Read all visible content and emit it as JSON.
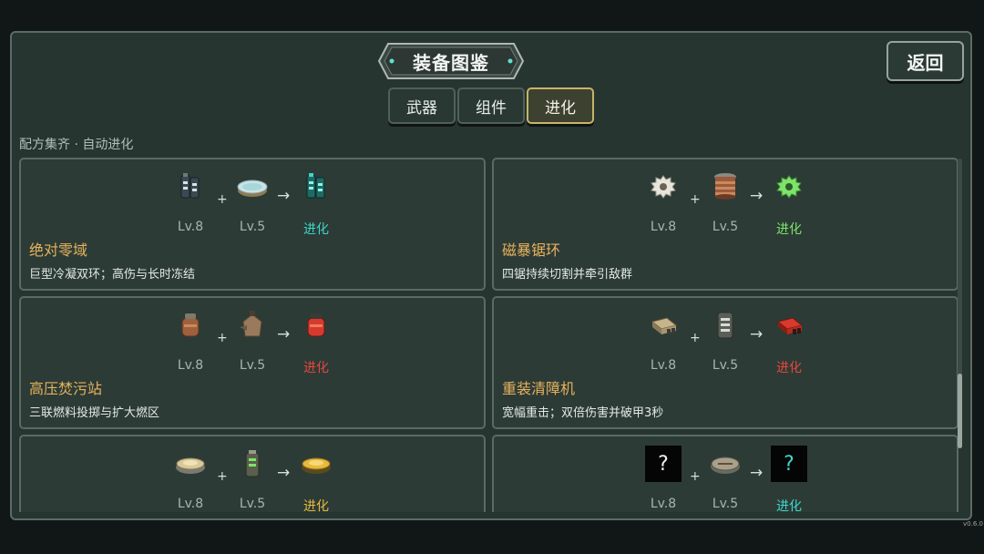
{
  "window": {
    "title": "装备图鉴",
    "back_label": "返回",
    "version": "v0.6.0"
  },
  "tabs": [
    {
      "label": "武器",
      "active": false
    },
    {
      "label": "组件",
      "active": false
    },
    {
      "label": "进化",
      "active": true
    }
  ],
  "subtitle": "配方集齐 · 自动进化",
  "colors": {
    "title_gold": "#e7b25c",
    "evolve_cyan": "#3fd6c9",
    "evolve_green": "#7ee36a",
    "evolve_red": "#e8463c",
    "evolve_yellow": "#e8b93c"
  },
  "recipes": [
    {
      "weapon": {
        "icon": "cryo-canister-icon",
        "level": "Lv.8"
      },
      "component": {
        "icon": "frost-disc-icon",
        "level": "Lv.5"
      },
      "result": {
        "icon": "cryo-canister-evolved-icon",
        "label": "进化",
        "color": "#3fd6c9"
      },
      "name": "绝对零域",
      "desc": "巨型冷凝双环；高伤与长时冻结"
    },
    {
      "weapon": {
        "icon": "saw-blade-icon",
        "level": "Lv.8"
      },
      "component": {
        "icon": "coil-magnet-icon",
        "level": "Lv.5"
      },
      "result": {
        "icon": "saw-blade-evolved-icon",
        "label": "进化",
        "color": "#7ee36a"
      },
      "name": "磁暴锯环",
      "desc": "四锯持续切割并牵引敌群"
    },
    {
      "weapon": {
        "icon": "fuel-tank-icon",
        "level": "Lv.8"
      },
      "component": {
        "icon": "incinerator-icon",
        "level": "Lv.5"
      },
      "result": {
        "icon": "fuel-tank-evolved-icon",
        "label": "进化",
        "color": "#e8463c"
      },
      "name": "高压焚污站",
      "desc": "三联燃料投掷与扩大燃区"
    },
    {
      "weapon": {
        "icon": "bulldozer-icon",
        "level": "Lv.8"
      },
      "component": {
        "icon": "armor-plate-icon",
        "level": "Lv.5"
      },
      "result": {
        "icon": "bulldozer-evolved-icon",
        "label": "进化",
        "color": "#e8463c"
      },
      "name": "重装清障机",
      "desc": "宽幅重击；双倍伤害并破甲3秒"
    },
    {
      "weapon": {
        "icon": "landmine-icon",
        "level": "Lv.8"
      },
      "component": {
        "icon": "battery-icon",
        "level": "Lv.5"
      },
      "result": {
        "icon": "landmine-evolved-icon",
        "label": "进化",
        "color": "#e8b93c"
      },
      "name": "",
      "desc": ""
    },
    {
      "weapon": {
        "icon": "unknown-icon",
        "level": "Lv.8",
        "unknown_text": "?"
      },
      "component": {
        "icon": "compass-icon",
        "level": "Lv.5"
      },
      "result": {
        "icon": "unknown-evolved-icon",
        "label": "进化",
        "color": "#3fd6c9",
        "unknown_text": "?"
      },
      "name": "",
      "desc": ""
    }
  ]
}
